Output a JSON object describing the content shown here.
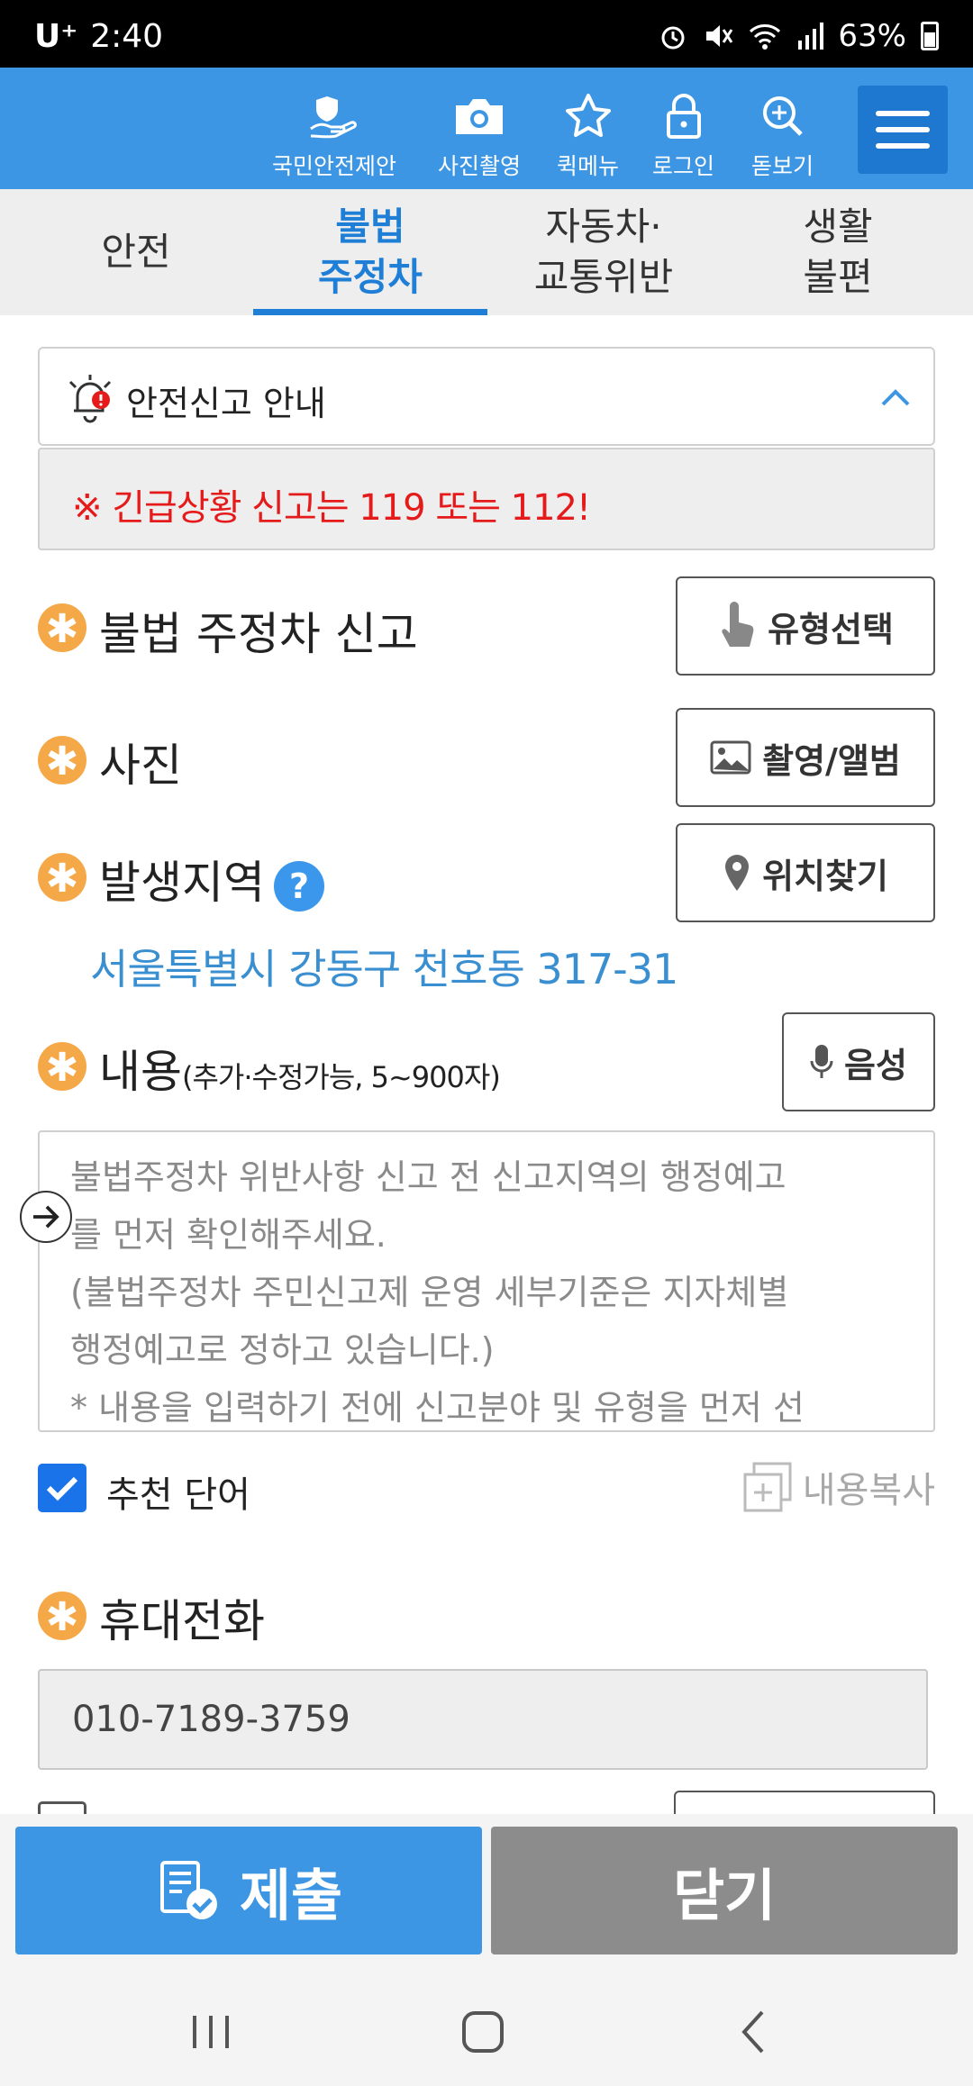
{
  "status_bar": {
    "carrier": "U⁺",
    "time": "2:40",
    "battery": "63%"
  },
  "header": {
    "buttons": [
      {
        "label": "국민안전제안",
        "icon": "hand-shield-icon"
      },
      {
        "label": "사진촬영",
        "icon": "camera-icon"
      },
      {
        "label": "퀵메뉴",
        "icon": "star-icon"
      },
      {
        "label": "로그인",
        "icon": "lock-icon"
      },
      {
        "label": "돋보기",
        "icon": "magnifier-plus-icon"
      }
    ],
    "menu_icon": "hamburger-menu-icon"
  },
  "tabs": [
    {
      "label": "안전",
      "active": false
    },
    {
      "label": "불법\n주정차",
      "active": true
    },
    {
      "label": "자동차·\n교통위반",
      "active": false
    },
    {
      "label": "생활\n불편",
      "active": false
    }
  ],
  "notice": {
    "title": "안전신고 안내",
    "emergency": "※ 긴급상황 신고는 119 또는 112!"
  },
  "form": {
    "required_mark": "✱",
    "type": {
      "label": "불법 주정차 신고",
      "button": "유형선택"
    },
    "photo": {
      "label": "사진",
      "button": "촬영/앨범"
    },
    "location": {
      "label": "발생지역",
      "help": "?",
      "button": "위치찾기",
      "address": "서울특별시 강동구 천호동 317-31"
    },
    "content": {
      "label": "내용",
      "hint": "(추가·수정가능, 5~900자)",
      "button": "음성",
      "placeholder": "불법주정차 위반사항 신고 전 신고지역의 행정예고\n를 먼저 확인해주세요.\n(불법주정차 주민신고제 운영 세부기준은 지자체별\n행정예고로 정하고 있습니다.)\n* 내용을 입력하기 전에 신고분야 및 유형을 먼저 선"
    },
    "recommend": {
      "label": "추천 단어",
      "checked": true
    },
    "copy_label": "내용복사",
    "phone": {
      "label": "휴대전화",
      "value": "010-7189-3759"
    }
  },
  "actions": {
    "submit": "제출",
    "close": "닫기"
  },
  "colors": {
    "primary": "#3d96e3",
    "accent_tab": "#1f7fd6",
    "required": "#f5a847",
    "emergency_text": "#e51b1b",
    "address": "#3a8fd1",
    "close_button": "#8c8c8c"
  }
}
